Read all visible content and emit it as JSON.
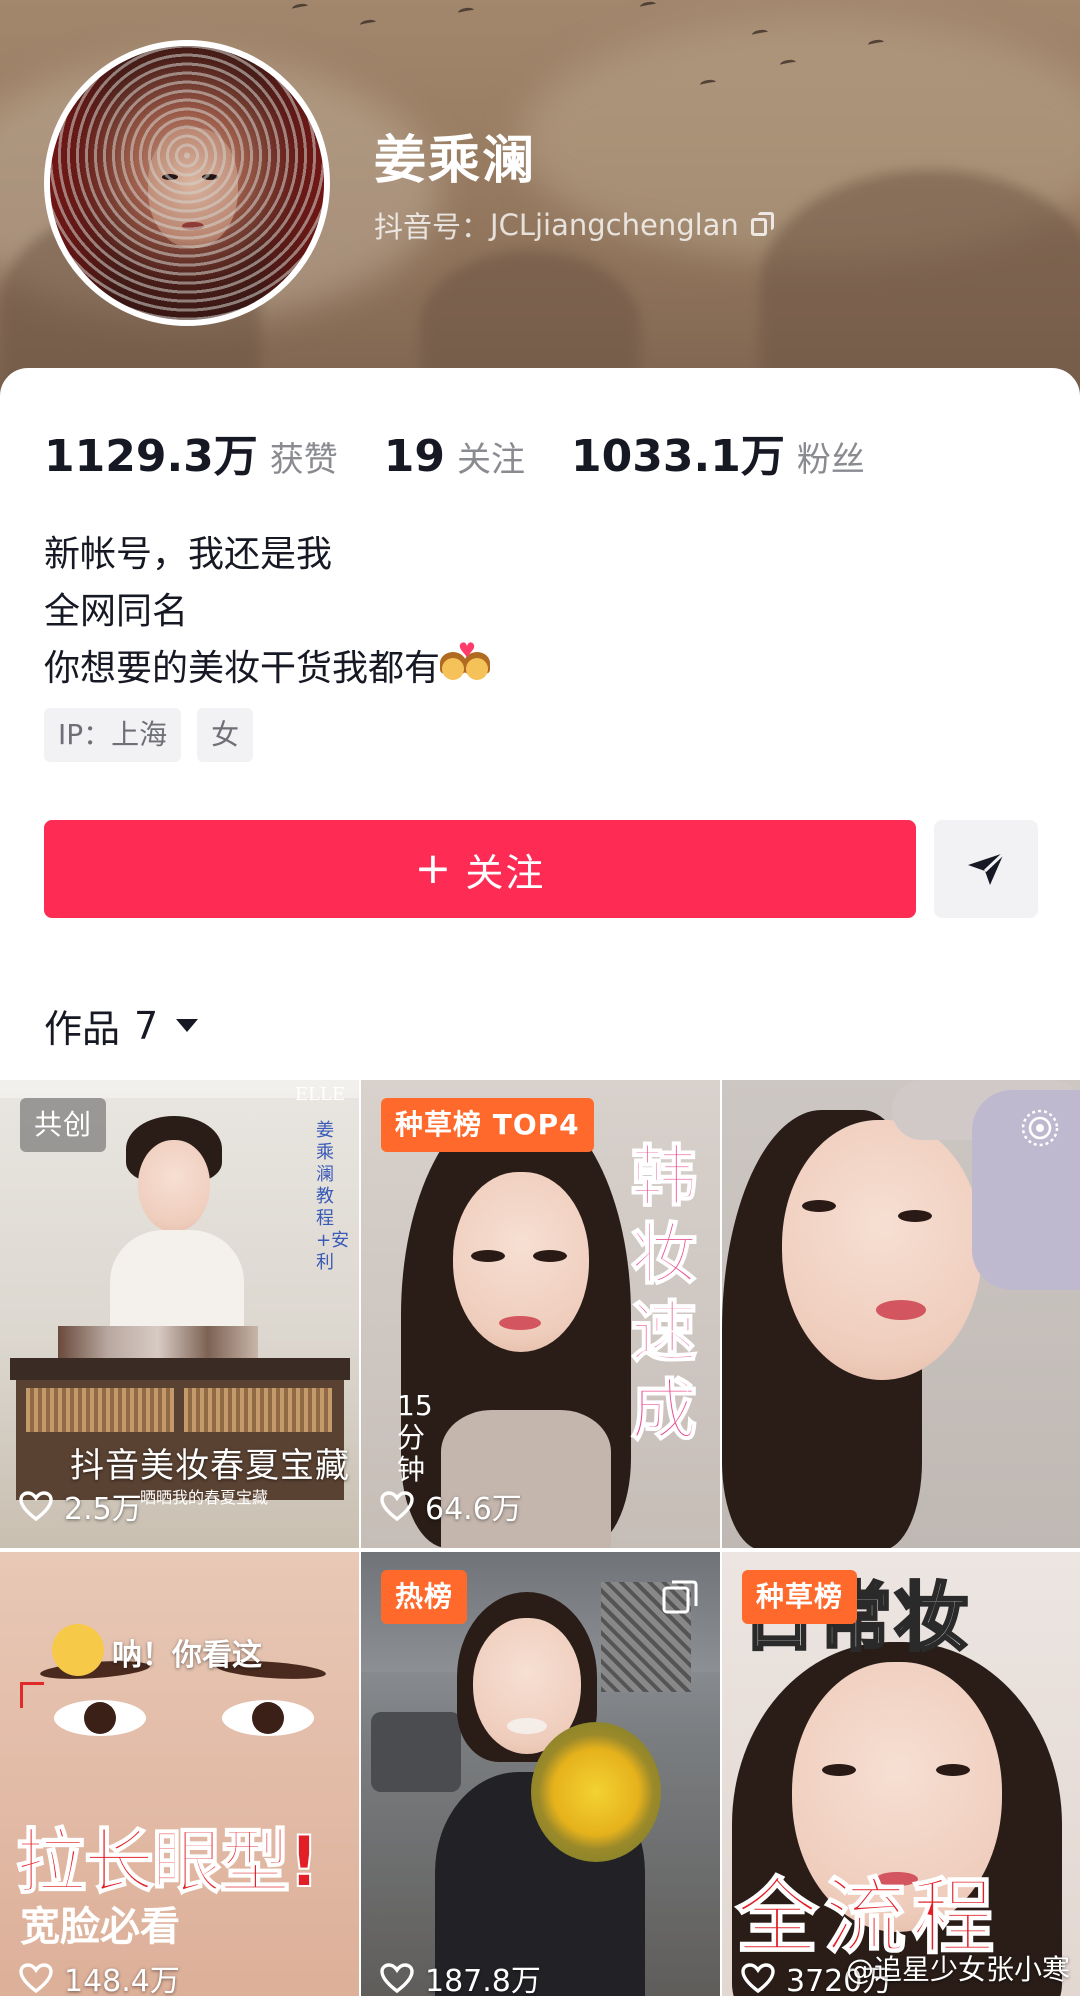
{
  "profile": {
    "name": "姜乘澜",
    "douyin_id_label": "抖音号：",
    "douyin_id": "JCLjiangchenglan"
  },
  "stats": [
    {
      "value": "1129.3万",
      "label": "获赞"
    },
    {
      "value": "19",
      "label": "关注"
    },
    {
      "value": "1033.1万",
      "label": "粉丝"
    }
  ],
  "bio": {
    "line1": "新帐号，我还是我",
    "line2": "全网同名",
    "line3": "你想要的美妆干货我都有"
  },
  "tags": {
    "ip": "IP：上海",
    "gender": "女"
  },
  "actions": {
    "follow_label": "关注",
    "follow_plus": "+"
  },
  "works": {
    "label": "作品",
    "count": "7"
  },
  "videos": [
    {
      "badge": "共创",
      "likes": "2.5万",
      "cover_text": "抖音美妆春夏宝藏",
      "cover_sub": "晒晒我的春夏宝藏",
      "brand": "ELLE",
      "side_text": "姜乘澜教程+安利"
    },
    {
      "badge": "种草榜 TOP4",
      "likes": "64.6万",
      "cover_text": "韩妆速成",
      "side_text": "15分钟"
    },
    {
      "badge": "",
      "likes": ""
    },
    {
      "badge": "",
      "likes": "148.4万",
      "cover_top": "呐！你看这",
      "cover_text": "拉长眼型!",
      "cover_sub": "宽脸必看"
    },
    {
      "badge": "热榜",
      "likes": "187.8万"
    },
    {
      "badge": "种草榜",
      "likes": "3720万",
      "cover_top": "日常妆",
      "cover_text": "全流程"
    }
  ],
  "watermark": "@追星少女张小寒",
  "colors": {
    "accent": "#fe2c55",
    "badge_orange": "#ff6a2c",
    "header": "#9a7e63"
  }
}
